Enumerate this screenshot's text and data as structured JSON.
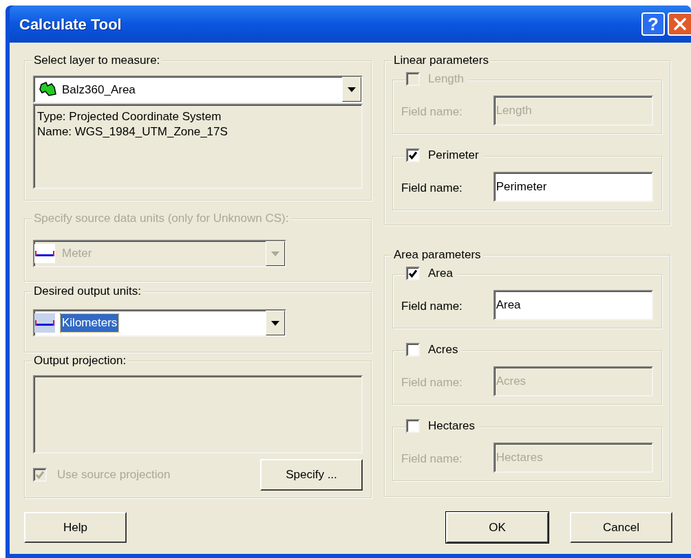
{
  "window": {
    "title": "Calculate Tool",
    "help_button": "?"
  },
  "layer_group": {
    "label": "Select layer to measure:",
    "layer": "Balz360_Area",
    "info_lines": [
      "Type: Projected Coordinate System",
      "Name: WGS_1984_UTM_Zone_17S"
    ]
  },
  "source_units": {
    "label": "Specify source data units (only for Unknown CS):",
    "value": "Meter",
    "disabled": true
  },
  "output_units": {
    "label": "Desired output units:",
    "value": "Kilometers",
    "disabled": false,
    "selected": true
  },
  "output_projection": {
    "label": "Output projection:",
    "use_source_projection": {
      "label": "Use source projection",
      "checked": true,
      "disabled": true
    },
    "specify_button": "Specify ..."
  },
  "linear_parameters": {
    "label": "Linear parameters",
    "items": [
      {
        "label": "Length",
        "checked": false,
        "disabled": true,
        "field_label": "Field name:",
        "field_value": "Length"
      },
      {
        "label": "Perimeter",
        "checked": true,
        "disabled": false,
        "field_label": "Field name:",
        "field_value": "Perimeter"
      }
    ]
  },
  "area_parameters": {
    "label": "Area parameters",
    "items": [
      {
        "label": "Area",
        "checked": true,
        "disabled": false,
        "field_label": "Field name:",
        "field_value": "Area"
      },
      {
        "label": "Acres",
        "checked": false,
        "disabled": false,
        "field_label": "Field name:",
        "field_value": "Acres"
      },
      {
        "label": "Hectares",
        "checked": false,
        "disabled": false,
        "field_label": "Field name:",
        "field_value": "Hectares"
      }
    ]
  },
  "buttons": [
    {
      "label": "Help",
      "default": false
    },
    {
      "label": "OK",
      "default": true
    },
    {
      "label": "Cancel",
      "default": false
    }
  ]
}
